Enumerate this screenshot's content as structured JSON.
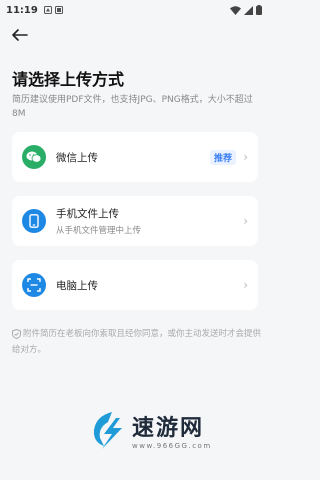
{
  "status": {
    "time": "11:19"
  },
  "header": {
    "title": "请选择上传方式",
    "subtitle": "简历建议使用PDF文件，也支持JPG、PNG格式，大小不超过8M"
  },
  "options": [
    {
      "label": "微信上传",
      "badge": "推荐",
      "icon": "wechat-icon",
      "color": "#2aae67"
    },
    {
      "label": "手机文件上传",
      "sub": "从手机文件管理中上传",
      "icon": "phone-icon",
      "color": "#1e88e5"
    },
    {
      "label": "电脑上传",
      "icon": "scan-icon",
      "color": "#1e88e5"
    }
  ],
  "notice": "附件简历在老板向你索取且经你同意，或你主动发送时才会提供给对方。",
  "watermark": {
    "title": "速游网",
    "url": "www.966GG.com"
  }
}
